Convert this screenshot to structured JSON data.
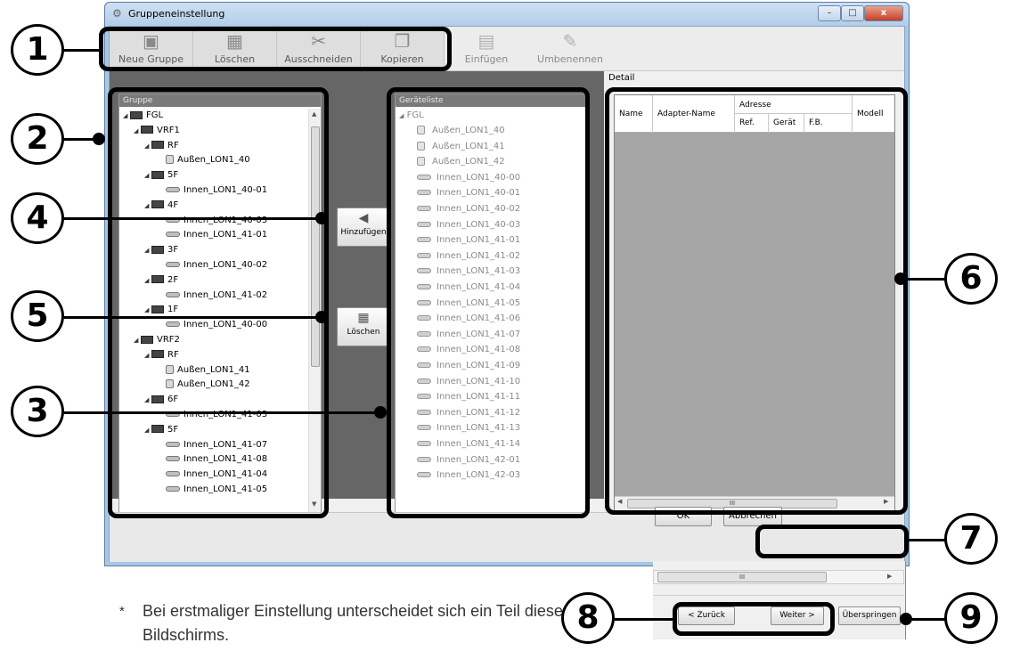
{
  "window": {
    "title": "Gruppeneinstellung",
    "controls": {
      "minimize": "–",
      "maximize": "□",
      "close": "x"
    }
  },
  "toolbar": {
    "items": [
      {
        "label": "Neue Gruppe",
        "icon": "new-group-icon",
        "enabled": true
      },
      {
        "label": "Löschen",
        "icon": "delete-icon",
        "enabled": true
      },
      {
        "label": "Ausschneiden",
        "icon": "cut-icon",
        "enabled": true
      },
      {
        "label": "Kopieren",
        "icon": "copy-icon",
        "enabled": true
      },
      {
        "label": "Einfügen",
        "icon": "paste-icon",
        "enabled": false
      },
      {
        "label": "Umbenennen",
        "icon": "rename-icon",
        "enabled": false
      }
    ]
  },
  "group_panel": {
    "title": "Gruppe",
    "tree": [
      {
        "label": "FGL",
        "level": 0,
        "kind": "group"
      },
      {
        "label": "VRF1",
        "level": 1,
        "kind": "group"
      },
      {
        "label": "RF",
        "level": 2,
        "kind": "group"
      },
      {
        "label": "Außen_LON1_40",
        "level": 3,
        "kind": "outdoor"
      },
      {
        "label": "5F",
        "level": 2,
        "kind": "group"
      },
      {
        "label": "Innen_LON1_40-01",
        "level": 3,
        "kind": "indoor"
      },
      {
        "label": "4F",
        "level": 2,
        "kind": "group"
      },
      {
        "label": "Innen_LON1_40-03",
        "level": 3,
        "kind": "indoor"
      },
      {
        "label": "Innen_LON1_41-01",
        "level": 3,
        "kind": "indoor"
      },
      {
        "label": "3F",
        "level": 2,
        "kind": "group"
      },
      {
        "label": "Innen_LON1_40-02",
        "level": 3,
        "kind": "indoor"
      },
      {
        "label": "2F",
        "level": 2,
        "kind": "group"
      },
      {
        "label": "Innen_LON1_41-02",
        "level": 3,
        "kind": "indoor"
      },
      {
        "label": "1F",
        "level": 2,
        "kind": "group"
      },
      {
        "label": "Innen_LON1_40-00",
        "level": 3,
        "kind": "indoor"
      },
      {
        "label": "VRF2",
        "level": 1,
        "kind": "group"
      },
      {
        "label": "RF",
        "level": 2,
        "kind": "group"
      },
      {
        "label": "Außen_LON1_41",
        "level": 3,
        "kind": "outdoor"
      },
      {
        "label": "Außen_LON1_42",
        "level": 3,
        "kind": "outdoor"
      },
      {
        "label": "6F",
        "level": 2,
        "kind": "group"
      },
      {
        "label": "Innen_LON1_41-03",
        "level": 3,
        "kind": "indoor"
      },
      {
        "label": "5F",
        "level": 2,
        "kind": "group"
      },
      {
        "label": "Innen_LON1_41-07",
        "level": 3,
        "kind": "indoor"
      },
      {
        "label": "Innen_LON1_41-08",
        "level": 3,
        "kind": "indoor"
      },
      {
        "label": "Innen_LON1_41-04",
        "level": 3,
        "kind": "indoor"
      },
      {
        "label": "Innen_LON1_41-05",
        "level": 3,
        "kind": "indoor"
      }
    ]
  },
  "device_panel": {
    "title": "Geräteliste",
    "root": "FGL",
    "items": [
      {
        "label": "Außen_LON1_40",
        "kind": "outdoor"
      },
      {
        "label": "Außen_LON1_41",
        "kind": "outdoor"
      },
      {
        "label": "Außen_LON1_42",
        "kind": "outdoor"
      },
      {
        "label": "Innen_LON1_40-00",
        "kind": "indoor"
      },
      {
        "label": "Innen_LON1_40-01",
        "kind": "indoor"
      },
      {
        "label": "Innen_LON1_40-02",
        "kind": "indoor"
      },
      {
        "label": "Innen_LON1_40-03",
        "kind": "indoor"
      },
      {
        "label": "Innen_LON1_41-01",
        "kind": "indoor"
      },
      {
        "label": "Innen_LON1_41-02",
        "kind": "indoor"
      },
      {
        "label": "Innen_LON1_41-03",
        "kind": "indoor"
      },
      {
        "label": "Innen_LON1_41-04",
        "kind": "indoor"
      },
      {
        "label": "Innen_LON1_41-05",
        "kind": "indoor"
      },
      {
        "label": "Innen_LON1_41-06",
        "kind": "indoor"
      },
      {
        "label": "Innen_LON1_41-07",
        "kind": "indoor"
      },
      {
        "label": "Innen_LON1_41-08",
        "kind": "indoor"
      },
      {
        "label": "Innen_LON1_41-09",
        "kind": "indoor"
      },
      {
        "label": "Innen_LON1_41-10",
        "kind": "indoor"
      },
      {
        "label": "Innen_LON1_41-11",
        "kind": "indoor"
      },
      {
        "label": "Innen_LON1_41-12",
        "kind": "indoor"
      },
      {
        "label": "Innen_LON1_41-13",
        "kind": "indoor"
      },
      {
        "label": "Innen_LON1_41-14",
        "kind": "indoor"
      },
      {
        "label": "Innen_LON1_42-01",
        "kind": "indoor"
      },
      {
        "label": "Innen_LON1_42-03",
        "kind": "indoor"
      }
    ]
  },
  "middle_buttons": {
    "add": {
      "label": "Hinzufügen",
      "icon": "arrow-left-icon"
    },
    "delete": {
      "label": "Löschen",
      "icon": "delete-icon"
    }
  },
  "detail": {
    "title": "Detail",
    "columns": {
      "name": "Name",
      "adapter": "Adapter-Name",
      "address": "Adresse",
      "ref": "Ref.",
      "device": "Gerät",
      "fb": "F.B.",
      "model": "Modell"
    },
    "scroll_mark": "III"
  },
  "footer": {
    "ok": "OK",
    "cancel": "Abbrechen"
  },
  "inset": {
    "scroll_mark": "III",
    "back": "< Zurück",
    "next": "Weiter >",
    "skip": "Überspringen"
  },
  "callouts": [
    "1",
    "2",
    "3",
    "4",
    "5",
    "6",
    "7",
    "8",
    "9"
  ],
  "note": {
    "star": "*",
    "text": "Bei erstmaliger Einstellung unterscheidet sich ein Teil dieses Bildschirms."
  }
}
